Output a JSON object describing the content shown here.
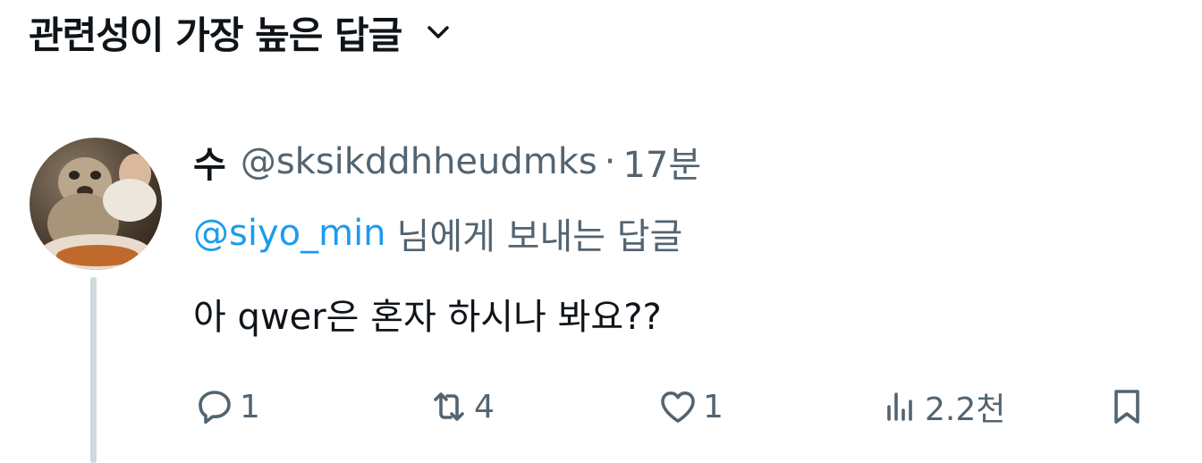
{
  "sort": {
    "label": "관련성이 가장 높은 답글",
    "icon": "chevron-down-icon"
  },
  "reply": {
    "display_name": "수",
    "handle": "@sksikddhheudmks",
    "separator": "·",
    "time": "17분",
    "replying_to": {
      "mention": "@siyo_min",
      "suffix": "님에게 보내는 답글"
    },
    "text": "아 qwer은 혼자 하시나 봐요??",
    "actions": {
      "reply_count": "1",
      "repost_count": "4",
      "like_count": "1",
      "views_count": "2.2천"
    }
  },
  "colors": {
    "text_primary": "#0f1419",
    "text_secondary": "#536471",
    "accent": "#1d9bf0",
    "thread_line": "#cfd9de"
  }
}
